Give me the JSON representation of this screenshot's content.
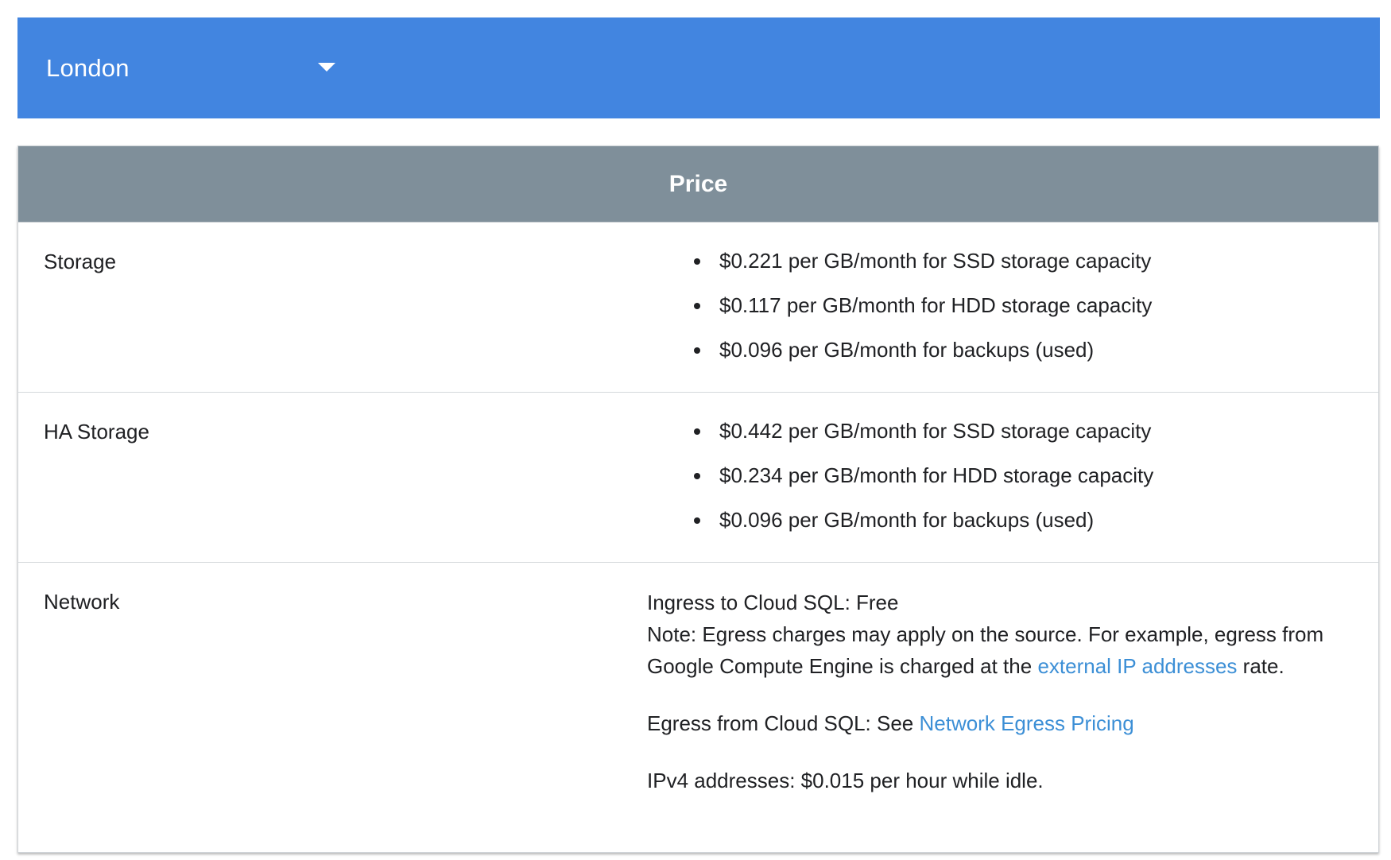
{
  "region": {
    "selected": "London"
  },
  "table": {
    "header": "Price",
    "storage": {
      "label": "Storage",
      "items": [
        "$0.221 per GB/month for SSD storage capacity",
        "$0.117 per GB/month for HDD storage capacity",
        "$0.096 per GB/month for backups (used)"
      ]
    },
    "ha_storage": {
      "label": "HA Storage",
      "items": [
        "$0.442 per GB/month for SSD storage capacity",
        "$0.234 per GB/month for HDD storage capacity",
        "$0.096 per GB/month for backups (used)"
      ]
    },
    "network": {
      "label": "Network",
      "ingress_line": "Ingress to Cloud SQL: Free",
      "note_prefix": "Note: Egress charges may apply on the source. For example, egress from Google Compute Engine is charged at the ",
      "note_link": "external IP addresses",
      "note_suffix": " rate.",
      "egress_prefix": "Egress from Cloud SQL: See ",
      "egress_link": "Network Egress Pricing",
      "ipv4_line": "IPv4 addresses: $0.015 per hour while idle."
    }
  },
  "colors": {
    "region_bar": "#4285e0",
    "table_header": "#7f8f9a",
    "link": "#3c8fd6"
  }
}
